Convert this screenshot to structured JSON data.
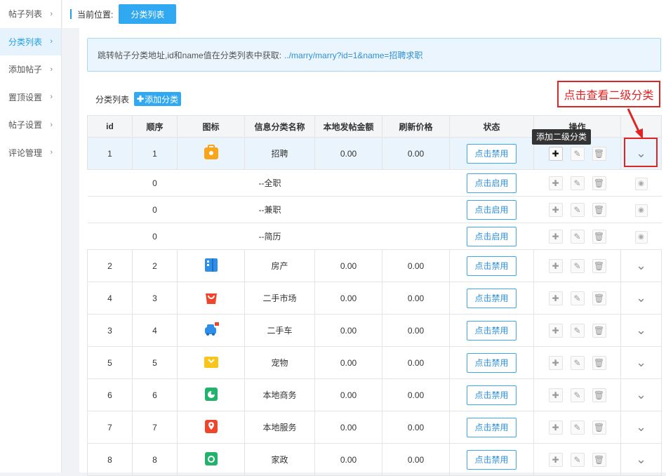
{
  "sidebar": {
    "items": [
      {
        "label": "帖子列表",
        "active": false
      },
      {
        "label": "分类列表",
        "active": true
      },
      {
        "label": "添加帖子",
        "active": false
      },
      {
        "label": "置顶设置",
        "active": false
      },
      {
        "label": "帖子设置",
        "active": false
      },
      {
        "label": "评论管理",
        "active": false
      }
    ]
  },
  "header": {
    "location_label": "当前位置:",
    "crumb": "分类列表"
  },
  "info": {
    "text": "跳转帖子分类地址,id和name值在分类列表中获取:",
    "url": "../marry/marry?id=1&name=招聘求职"
  },
  "list": {
    "title": "分类列表",
    "add_label": "添加分类"
  },
  "callout": {
    "text": "点击查看二级分类"
  },
  "tooltip": {
    "text": "添加二级分类"
  },
  "table": {
    "columns": [
      "id",
      "顺序",
      "图标",
      "信息分类名称",
      "本地发帖金额",
      "刷新价格",
      "状态",
      "操作"
    ],
    "rows": [
      {
        "kind": "main",
        "id": "1",
        "order": "1",
        "icon": "briefcase-icon",
        "color": "#f9a51a",
        "name": "招聘",
        "post_fee": "0.00",
        "refresh": "0.00",
        "status": "点击禁用",
        "highlight": true
      },
      {
        "kind": "sub",
        "id": "",
        "order": "0",
        "name": "--全职",
        "status": "点击启用"
      },
      {
        "kind": "sub",
        "id": "",
        "order": "0",
        "name": "--兼职",
        "status": "点击启用"
      },
      {
        "kind": "sub",
        "id": "",
        "order": "0",
        "name": "--简历",
        "status": "点击启用"
      },
      {
        "kind": "main",
        "id": "2",
        "order": "2",
        "icon": "building-icon",
        "color": "#2f8fe8",
        "name": "房产",
        "post_fee": "0.00",
        "refresh": "0.00",
        "status": "点击禁用"
      },
      {
        "kind": "main",
        "id": "4",
        "order": "3",
        "icon": "shopping-bag-icon",
        "color": "#f0452d",
        "name": "二手市场",
        "post_fee": "0.00",
        "refresh": "0.00",
        "status": "点击禁用"
      },
      {
        "kind": "main",
        "id": "3",
        "order": "4",
        "icon": "car-icon",
        "color": "#2f8fe8",
        "name": "二手车",
        "post_fee": "0.00",
        "refresh": "0.00",
        "status": "点击禁用"
      },
      {
        "kind": "main",
        "id": "5",
        "order": "5",
        "icon": "pet-icon",
        "color": "#f9c51a",
        "name": "宠物",
        "post_fee": "0.00",
        "refresh": "0.00",
        "status": "点击禁用"
      },
      {
        "kind": "main",
        "id": "6",
        "order": "6",
        "icon": "business-icon",
        "color": "#21b36b",
        "name": "本地商务",
        "post_fee": "0.00",
        "refresh": "0.00",
        "status": "点击禁用"
      },
      {
        "kind": "main",
        "id": "7",
        "order": "7",
        "icon": "location-pin-icon",
        "color": "#f0452d",
        "name": "本地服务",
        "post_fee": "0.00",
        "refresh": "0.00",
        "status": "点击禁用"
      },
      {
        "kind": "main",
        "id": "8",
        "order": "8",
        "icon": "housekeeping-icon",
        "color": "#21b36b",
        "name": "家政",
        "post_fee": "0.00",
        "refresh": "0.00",
        "status": "点击禁用"
      }
    ]
  }
}
